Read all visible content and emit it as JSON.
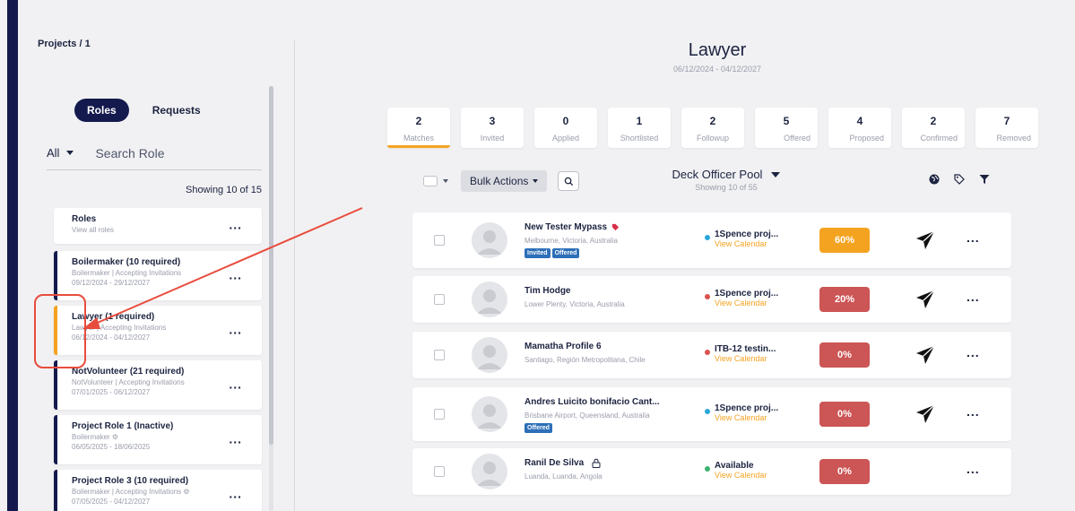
{
  "breadcrumb": "Projects / 1",
  "roles_panel": {
    "toggle_roles": "Roles",
    "toggle_requests": "Requests",
    "filter_all": "All",
    "search_placeholder": "Search Role",
    "showing": "Showing 10 of 15",
    "cards": [
      {
        "title": "Roles",
        "sub1": "View all roles",
        "sub2": "",
        "bar": "none"
      },
      {
        "title": "Boilermaker (10 required)",
        "sub1": "Boilermaker | Accepting Invitations",
        "sub2": "09/12/2024 - 29/12/2027",
        "bar": "navy"
      },
      {
        "title": "Lawyer (1 required)",
        "sub1": "Lawyer | Accepting Invitations",
        "sub2": "06/12/2024 - 04/12/2027",
        "bar": "orange"
      },
      {
        "title": "NotVolunteer (21 required)",
        "sub1": "NotVolunteer | Accepting Invitations",
        "sub2": "07/01/2025 - 06/12/2027",
        "bar": "navy"
      },
      {
        "title": "Project Role 1 (Inactive)",
        "sub1": "Boilermaker ⚙",
        "sub2": "06/05/2025 - 18/06/2025",
        "bar": "navy"
      },
      {
        "title": "Project Role 3 (10 required)",
        "sub1": "Boilermaker | Accepting Invitations ⚙",
        "sub2": "07/05/2025 - 04/12/2027",
        "bar": "navy"
      }
    ],
    "dots": "..."
  },
  "header": {
    "title": "Lawyer",
    "dates": "06/12/2024 - 04/12/2027"
  },
  "stats": [
    {
      "num": "2",
      "label": "Matches",
      "active": true
    },
    {
      "num": "3",
      "label": "Invited"
    },
    {
      "num": "0",
      "label": "Applied"
    },
    {
      "num": "1",
      "label": "Shortlisted"
    },
    {
      "num": "2",
      "label": "Followup"
    },
    {
      "num": "5",
      "label": "Offered"
    },
    {
      "num": "4",
      "label": "Proposed"
    },
    {
      "num": "2",
      "label": "Confirmed"
    },
    {
      "num": "7",
      "label": "Removed"
    }
  ],
  "toolbar": {
    "bulk_actions": "Bulk Actions",
    "pool_title": "Deck Officer Pool",
    "pool_showing": "Showing 10 of 55"
  },
  "candidates": [
    {
      "name": "New Tester Mypass",
      "location": "Melbourne, Victoria, Australia",
      "badges": [
        "Invited",
        "Offered"
      ],
      "project": "1Spence proj...",
      "project_dot": "#2aa7d9",
      "calendar": "View Calendar",
      "match": "60%",
      "match_color": "#f4a321",
      "send": true,
      "tag": true,
      "lock": false
    },
    {
      "name": "Tim Hodge",
      "location": "Lower Plenty, Victoria, Australia",
      "badges": [],
      "project": "1Spence proj...",
      "project_dot": "#d9534f",
      "calendar": "View Calendar",
      "match": "20%",
      "match_color": "#cc5555",
      "send": true,
      "tag": false,
      "lock": false
    },
    {
      "name": "Mamatha Profile 6",
      "location": "Santiago, Región Metropolitana, Chile",
      "badges": [],
      "project": "ITB-12 testin...",
      "project_dot": "#d9534f",
      "calendar": "View Calendar",
      "match": "0%",
      "match_color": "#cc5555",
      "send": true,
      "tag": false,
      "lock": false
    },
    {
      "name": "Andres Luicito bonifacio Cant...",
      "location": "Brisbane Airport, Queensland, Australia",
      "badges": [
        "Offered"
      ],
      "project": "1Spence proj...",
      "project_dot": "#2aa7d9",
      "calendar": "View Calendar",
      "match": "0%",
      "match_color": "#cc5555",
      "send": true,
      "tag": false,
      "lock": false
    },
    {
      "name": "Ranil De Silva",
      "location": "Luanda, Luanda, Angola",
      "badges": [],
      "project": "Available",
      "project_dot": "#3cb371",
      "calendar": "View Calendar",
      "match": "0%",
      "match_color": "#cc5555",
      "send": false,
      "tag": false,
      "lock": true
    }
  ],
  "colors": {
    "navy": "#141a4d",
    "orange": "#f4a321",
    "red": "#cc5555",
    "annotation": "#e84c3d"
  }
}
